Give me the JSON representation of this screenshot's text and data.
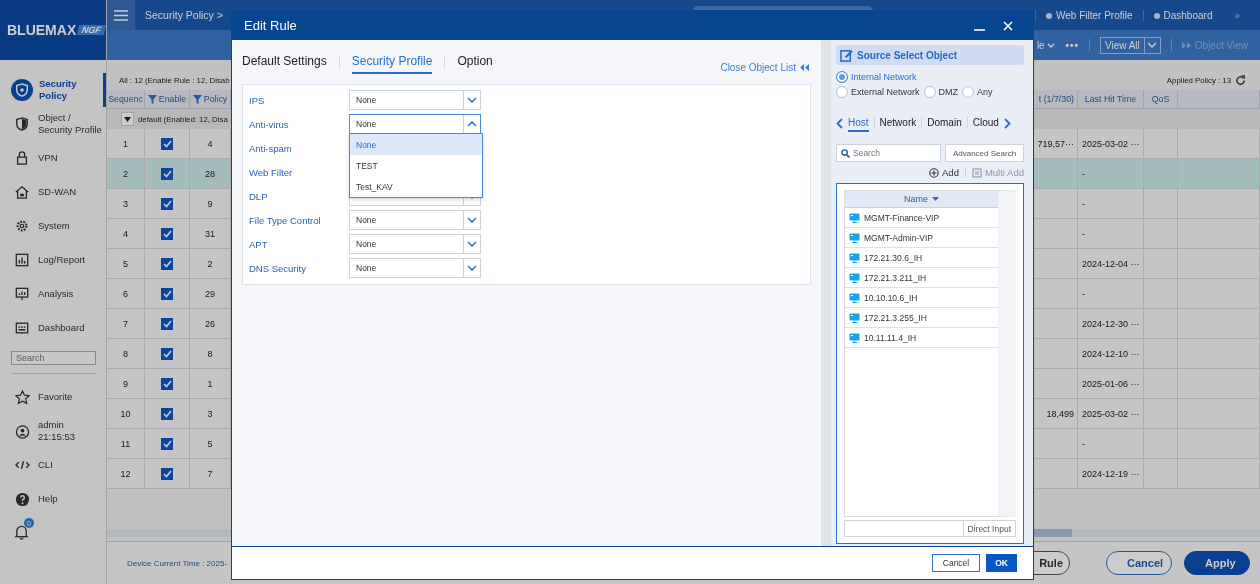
{
  "app": {
    "logo": "BLUEMAX",
    "logo_badge": "NGF"
  },
  "sidebar": {
    "items": [
      {
        "label": "Security Policy",
        "selected": true
      },
      {
        "label": "Object / Security Profile",
        "selected": false
      },
      {
        "label": "VPN",
        "selected": false
      },
      {
        "label": "SD-WAN",
        "selected": false
      },
      {
        "label": "System",
        "selected": false
      },
      {
        "label": "Log/Report",
        "selected": false
      },
      {
        "label": "Analysis",
        "selected": false
      },
      {
        "label": "Dashboard",
        "selected": false
      }
    ],
    "search": {
      "placeholder": "Search"
    },
    "bottom_items": [
      {
        "kind": "favorite",
        "label": "Favorite"
      },
      {
        "kind": "user",
        "label": "admin",
        "time": "21:15:53"
      },
      {
        "kind": "cli",
        "label": "CLI"
      },
      {
        "kind": "help",
        "label": "Help"
      }
    ],
    "notifications": {
      "count": "0"
    }
  },
  "topbar": {
    "title": "Security Policy",
    "separator": ">",
    "tabs": [
      {
        "selected": true
      },
      {
        "label": "Web Filter Profile",
        "selected": false
      },
      {
        "label": "Dashboard",
        "selected": false
      }
    ],
    "more": "»"
  },
  "toolbar": {
    "cut_label": "le",
    "more": "•••",
    "view": "View All",
    "object_view": {
      "label": "Object View",
      "disabled": true
    }
  },
  "summary": "All : 12 (Enable Rule : 12, Disab",
  "applied": "Applied Policy : 13",
  "table": {
    "columns_left": [
      "Sequenc",
      "Enable",
      "Policy"
    ],
    "columns_right": [
      "t (1/7/30)",
      "Last Hit Time",
      "QoS"
    ],
    "group": "default (Enabled: 12, Disa",
    "rows": [
      {
        "sequence": "1",
        "enabled": true,
        "policy": "4",
        "hits": "719,57···",
        "last_hit": "2025-03-02 ···",
        "selected": false
      },
      {
        "sequence": "2",
        "enabled": true,
        "policy": "28",
        "last_hit": "-",
        "selected": true
      },
      {
        "sequence": "3",
        "enabled": true,
        "policy": "9",
        "last_hit": "-",
        "selected": false
      },
      {
        "sequence": "4",
        "enabled": true,
        "policy": "31",
        "last_hit": "-",
        "selected": false
      },
      {
        "sequence": "5",
        "enabled": true,
        "policy": "2",
        "last_hit": "2024-12-04 ···",
        "selected": false
      },
      {
        "sequence": "6",
        "enabled": true,
        "policy": "29",
        "last_hit": "-",
        "selected": false
      },
      {
        "sequence": "7",
        "enabled": true,
        "policy": "26",
        "last_hit": "2024-12-30 ···",
        "selected": false
      },
      {
        "sequence": "8",
        "enabled": true,
        "policy": "8",
        "last_hit": "2024-12-10 ···",
        "selected": false
      },
      {
        "sequence": "9",
        "enabled": true,
        "policy": "1",
        "last_hit": "2025-01-06 ···",
        "selected": false
      },
      {
        "sequence": "10",
        "enabled": true,
        "policy": "3",
        "hits": "18,499",
        "last_hit": "2025-03-02 ···",
        "selected": false
      },
      {
        "sequence": "11",
        "enabled": true,
        "policy": "5",
        "last_hit": "-",
        "selected": false
      },
      {
        "sequence": "12",
        "enabled": true,
        "policy": "7",
        "last_hit": "2024-12-19 ···",
        "selected": false
      }
    ]
  },
  "footer": {
    "device_time": "Device Current Time : 2025-",
    "buttons": [
      {
        "label": "Rule",
        "kind": "outline-dark"
      },
      {
        "label": "Cancel",
        "kind": "outline"
      },
      {
        "label": "Apply",
        "kind": "primary"
      }
    ]
  },
  "modal": {
    "title": "Edit Rule",
    "tabs": [
      {
        "label": "Default Settings",
        "selected": false
      },
      {
        "label": "Security Profile",
        "selected": true
      },
      {
        "label": "Option",
        "selected": false
      }
    ],
    "close_list": "Close Object List",
    "fields": [
      {
        "label": "IPS",
        "value": "None",
        "expanded": false
      },
      {
        "label": "Anti-virus",
        "value": "None",
        "expanded": true,
        "options": [
          {
            "label": "None",
            "selected": true
          },
          {
            "label": "TEST",
            "selected": false
          },
          {
            "label": "Test_KAV",
            "selected": false
          }
        ]
      },
      {
        "label": "Anti-spam"
      },
      {
        "label": "Web Filter"
      },
      {
        "label": "DLP",
        "expanded": false
      },
      {
        "label": "File Type Control",
        "value": "None",
        "expanded": false
      },
      {
        "label": "APT",
        "value": "None",
        "expanded": false
      },
      {
        "label": "DNS Security",
        "value": "None",
        "expanded": false
      }
    ],
    "object_panel": {
      "title": "Source Select Object",
      "zones": [
        {
          "label": "Internal Network",
          "selected": true
        },
        {
          "label": "External Network",
          "selected": false
        },
        {
          "label": "DMZ",
          "selected": false
        },
        {
          "label": "Any",
          "selected": false
        }
      ],
      "tabs": [
        {
          "label": "Host",
          "selected": true
        },
        {
          "label": "Network",
          "selected": false
        },
        {
          "label": "Domain",
          "selected": false
        },
        {
          "label": "Cloud",
          "selected": false
        }
      ],
      "search": {
        "placeholder": "Search"
      },
      "advanced": "Advanced Search",
      "add": "Add",
      "multi_add": {
        "label": "Multi Add",
        "disabled": true
      },
      "column": "Name",
      "items": [
        "MGMT-Finance-VIP",
        "MGMT-Admin-VIP",
        "172.21.30.6_IH",
        "172.21.3.211_IH",
        "10.10.10.6_IH",
        "172.21.3.255_IH",
        "10.11.11.4_IH"
      ],
      "direct_input": "Direct Input"
    },
    "buttons": [
      {
        "label": "Cancel",
        "kind": "secondary"
      },
      {
        "label": "OK",
        "kind": "primary"
      }
    ]
  }
}
